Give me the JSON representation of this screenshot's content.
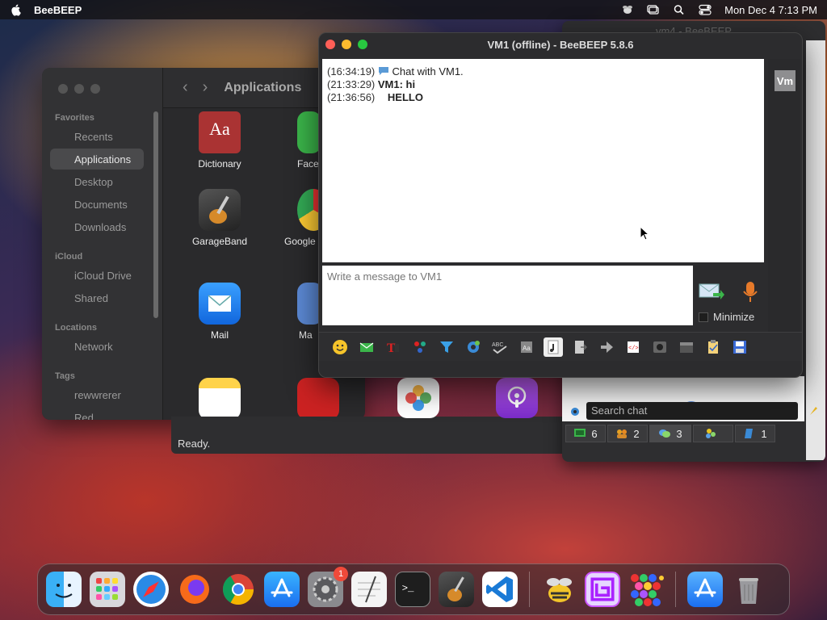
{
  "menubar": {
    "app_name": "BeeBEEP",
    "datetime": "Mon Dec 4  7:13 PM",
    "icons": [
      "apple-icon",
      "beebeep-menu-icon",
      "window-icon",
      "search-icon",
      "control-center-icon"
    ]
  },
  "finder": {
    "title": "Applications",
    "sidebar": {
      "favorites_label": "Favorites",
      "favorites": [
        "Recents",
        "Applications",
        "Desktop",
        "Documents",
        "Downloads"
      ],
      "icloud_label": "iCloud",
      "icloud": [
        "iCloud Drive",
        "Shared"
      ],
      "locations_label": "Locations",
      "locations": [
        "Network"
      ],
      "tags_label": "Tags",
      "tags": [
        "rewwrerer",
        "Red"
      ]
    },
    "apps": [
      "Dictionary",
      "Face",
      "GarageBand",
      "Google",
      "Mail",
      "Ma"
    ]
  },
  "chat": {
    "title": "VM1 (offline) - BeeBEEP 5.8.6",
    "messages": [
      {
        "time": "(16:34:19)",
        "sender": "",
        "text": "Chat with VM1."
      },
      {
        "time": "(21:33:29)",
        "sender": "VM1: hi",
        "text": ""
      },
      {
        "time": "(21:36:56)",
        "sender": "",
        "text": "HELLO"
      }
    ],
    "avatar": "Vm",
    "compose_placeholder": "Write a message to VM1",
    "minimize_label": "Minimize"
  },
  "main_window": {
    "title": "vm4 - BeeBEEP",
    "search_placeholder": "Search chat",
    "tabs": [
      {
        "icon": "users-icon",
        "count": "6"
      },
      {
        "icon": "group-icon",
        "count": "2"
      },
      {
        "icon": "chat-icon",
        "count": "3"
      },
      {
        "icon": "people-icon",
        "count": ""
      },
      {
        "icon": "file-icon",
        "count": "1"
      }
    ]
  },
  "status_window": {
    "status": "Ready."
  },
  "dock": {
    "settings_badge": "1",
    "items": [
      "Finder",
      "Launchpad",
      "Safari",
      "Firefox",
      "Chrome",
      "App Store",
      "System Settings",
      "TextEdit",
      "Terminal",
      "GarageBand",
      "VS Code",
      "BeeBEEP",
      "Puzzle",
      "Bubbles",
      "Downloads",
      "Trash"
    ]
  },
  "colors": {
    "close": "#fe5f57",
    "minimize": "#febc2e",
    "zoom": "#28c840",
    "badge": "#f04a3a"
  }
}
